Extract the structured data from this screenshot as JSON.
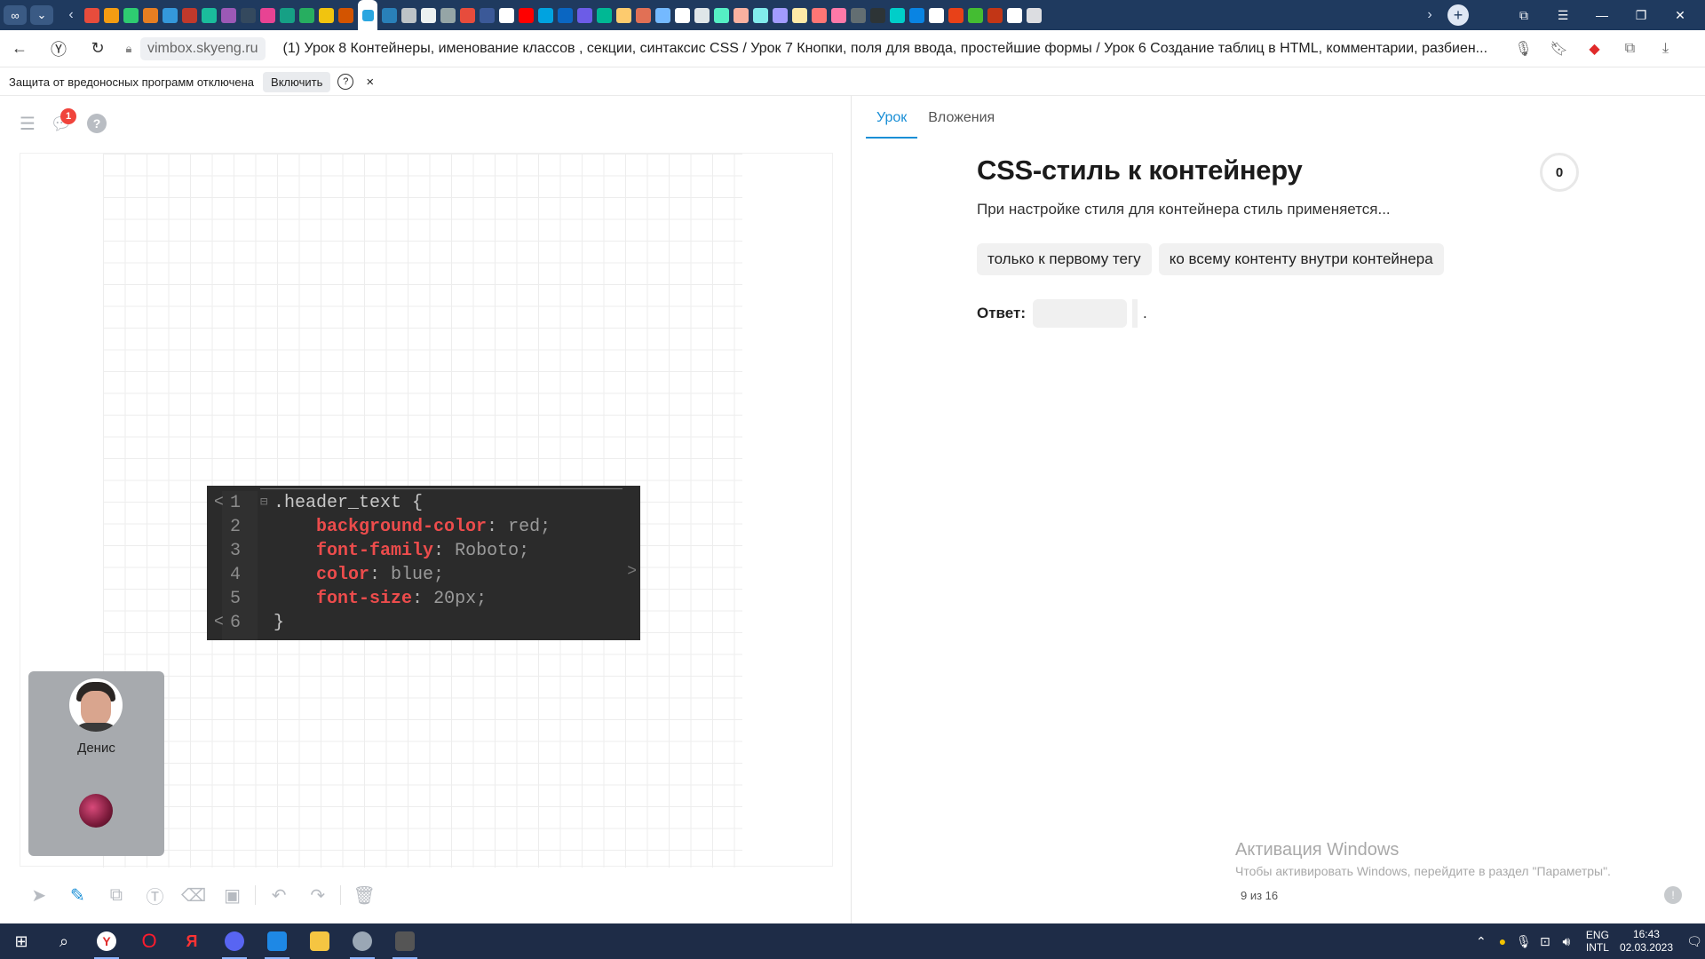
{
  "browser": {
    "tab_url_domain": "vimbox.skyeng.ru",
    "page_title": "(1) Урок 8 Контейнеры, именование классов , секции, синтаксис CSS / Урок 7 Кнопки, поля для ввода, простейшие формы / Урок 6 Создание таблиц в HTML, комментарии, разбиен...",
    "favicon_colors": [
      "#e74c3c",
      "#f39c12",
      "#2ecc71",
      "#e67e22",
      "#3498db",
      "#c0392b",
      "#1abc9c",
      "#9b59b6",
      "#34495e",
      "#e84393",
      "#16a085",
      "#27ae60",
      "#f1c40f",
      "#d35400",
      "#8e44ad",
      "#2980b9",
      "#bdc3c7",
      "#ecf0f1",
      "#95a5a6",
      "#e74c3c",
      "#3b5998",
      "#ffffff",
      "#ff0000",
      "#00a3e0",
      "#0a66c2",
      "#6c5ce7",
      "#00b894",
      "#fdcb6e",
      "#e17055",
      "#74b9ff",
      "#ffffff",
      "#dfe6e9",
      "#55efc4",
      "#fab1a0",
      "#81ecec",
      "#a29bfe",
      "#ffeaa7",
      "#ff7675",
      "#fd79a8",
      "#636e72",
      "#2d3436",
      "#00cec9",
      "#0984e3",
      "#ffffff",
      "#e84118",
      "#44bd32",
      "#c23616",
      "#ffffff",
      "#dcdde1"
    ]
  },
  "notice": {
    "text": "Защита от вредоносных программ отключена",
    "enable_label": "Включить",
    "help_label": "?",
    "close_label": "×"
  },
  "board": {
    "notification_count": "1",
    "help_label": "?",
    "code_lines": [
      {
        "num": "1",
        "arrow": "<",
        "fold": "⊟",
        "selector": ".header_text {"
      },
      {
        "num": "2",
        "prop": "background-color",
        "value": "red;"
      },
      {
        "num": "3",
        "prop": "font-family",
        "value": "Roboto;"
      },
      {
        "num": "4",
        "prop": "color",
        "value": "blue;"
      },
      {
        "num": "5",
        "prop": "font-size",
        "value": "20px;"
      },
      {
        "num": "6",
        "arrow": "<",
        "selector": "}"
      }
    ],
    "right_arrow": ">",
    "participant": {
      "name": "Денис"
    }
  },
  "lesson": {
    "tabs": [
      {
        "label": "Урок",
        "active": true
      },
      {
        "label": "Вложения",
        "active": false
      }
    ],
    "title": "CSS-стиль к контейнеру",
    "score": "0",
    "question": "При настройке стиля для контейнера стиль применяется...",
    "options": [
      "только к первому тегу",
      "ко всему контенту внутри контейнера"
    ],
    "answer_label": "Ответ:",
    "answer_tail": ".",
    "pager": "9 из 16"
  },
  "windows": {
    "activation_title": "Активация Windows",
    "activation_text": "Чтобы активировать Windows, перейдите в раздел \"Параметры\".",
    "lang_line1": "ENG",
    "lang_line2": "INTL",
    "time": "16:43",
    "date": "02.03.2023"
  },
  "colors": {
    "accent": "#1a8fd6",
    "code_keyword": "#ec4c4c",
    "code_bg": "#2b2b2b",
    "badge": "#f0443c"
  }
}
